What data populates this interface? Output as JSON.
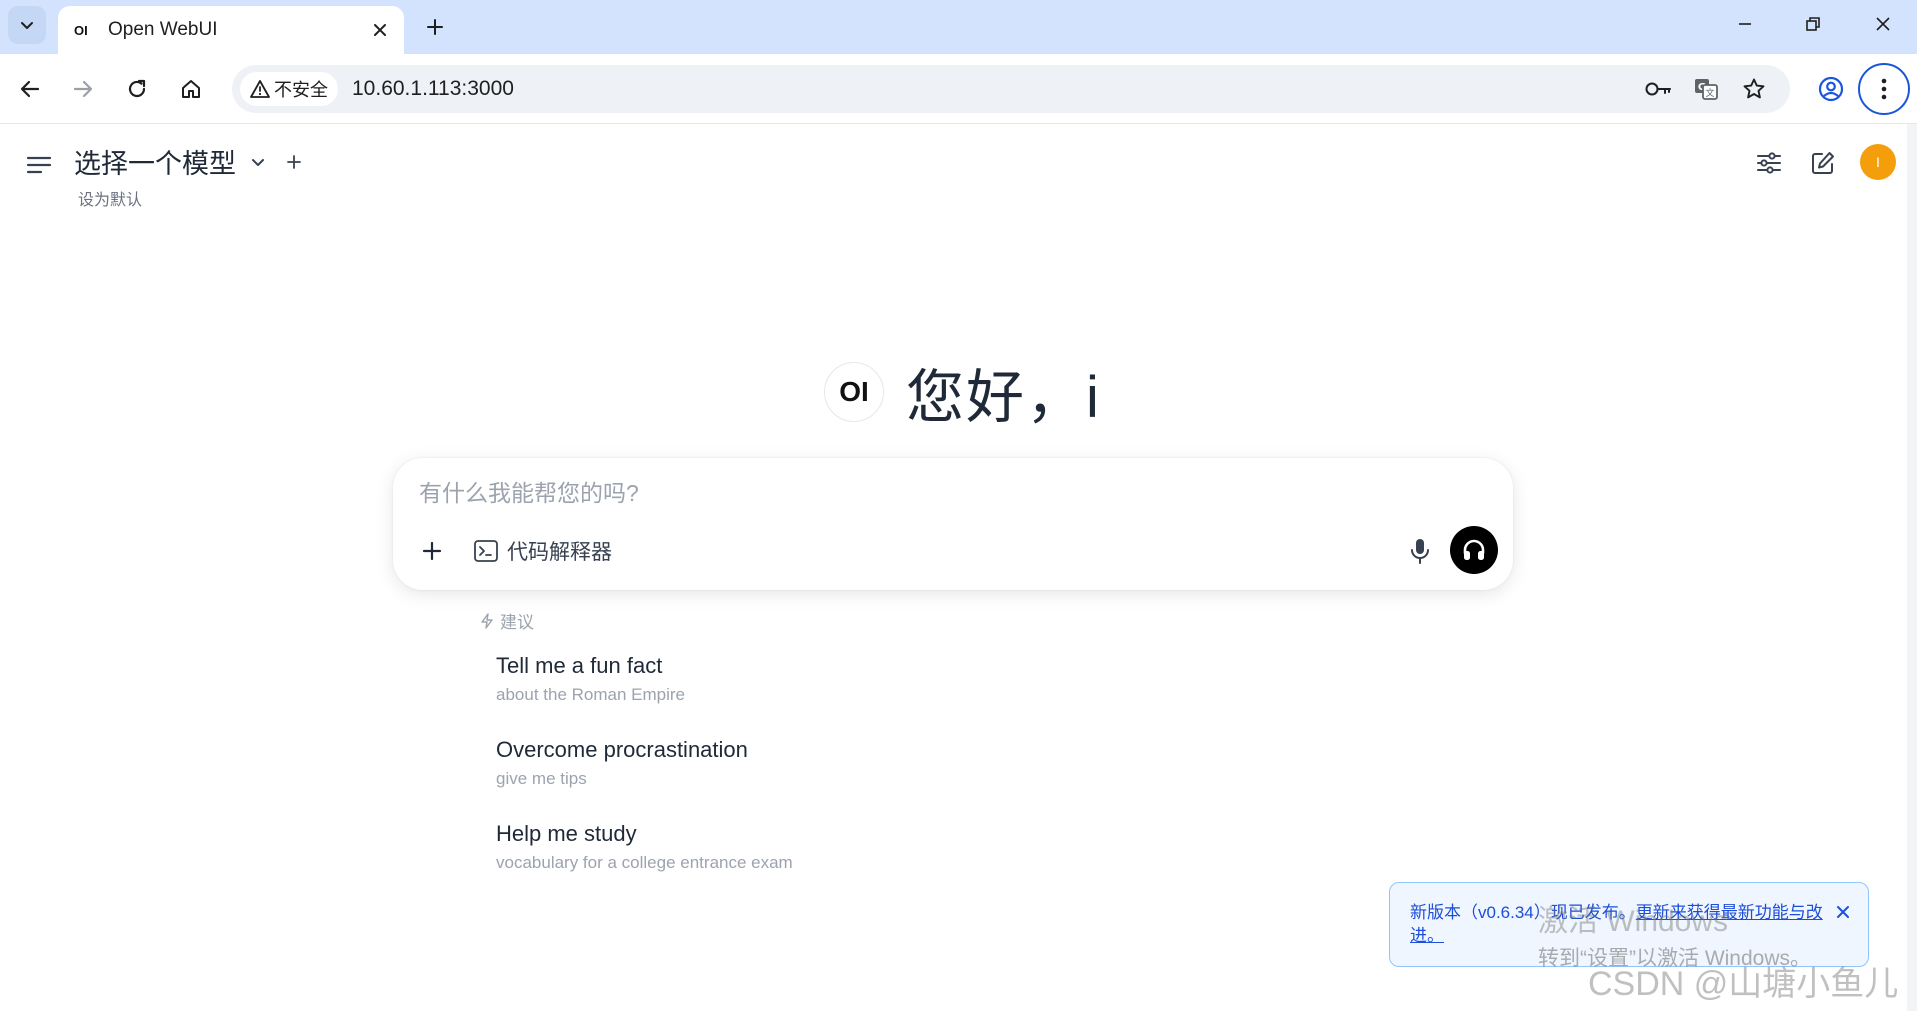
{
  "browser": {
    "tab_title": "Open WebUI",
    "tab_favicon": "OI",
    "security_label": "不安全",
    "url": "10.60.1.113:3000"
  },
  "header": {
    "model_title": "选择一个模型",
    "set_default": "设为默认",
    "avatar_initial": "I",
    "avatar_color": "#f59e0b"
  },
  "greeting": {
    "logo": "OI",
    "text": "您好，i"
  },
  "prompt": {
    "placeholder": "有什么我能帮您的吗?",
    "value": "",
    "code_interpreter_label": "代码解释器"
  },
  "suggestions": {
    "header": "建议",
    "items": [
      {
        "title": "Tell me a fun fact",
        "subtitle": "about the Roman Empire"
      },
      {
        "title": "Overcome procrastination",
        "subtitle": "give me tips"
      },
      {
        "title": "Help me study",
        "subtitle": "vocabulary for a college entrance exam"
      }
    ]
  },
  "toast": {
    "version_text": "新版本（v0.6.34）现已发布。",
    "link_text": "更新来获得最新功能与改进。",
    "accent": "#1d4ed8"
  },
  "overlays": {
    "windows_title": "激活 Windows",
    "windows_sub": "转到“设置”以激活 Windows。",
    "csdn": "CSDN @山塘小鱼儿"
  },
  "icons": {
    "tab_list": "chevron-down-icon",
    "close_tab": "close-icon",
    "new_tab": "plus-icon",
    "back": "arrow-left-icon",
    "forward": "arrow-right-icon",
    "reload": "reload-icon",
    "home": "home-icon",
    "warning": "warning-triangle-icon",
    "password": "key-icon",
    "translate": "translate-icon",
    "bookmark": "star-icon",
    "profile": "profile-icon",
    "menu": "more-vertical-icon",
    "sidebar": "menu-lines-icon",
    "controls": "sliders-icon",
    "new_chat": "edit-icon",
    "mic": "microphone-icon",
    "voice": "headphones-icon",
    "suggestion": "bolt-icon"
  }
}
